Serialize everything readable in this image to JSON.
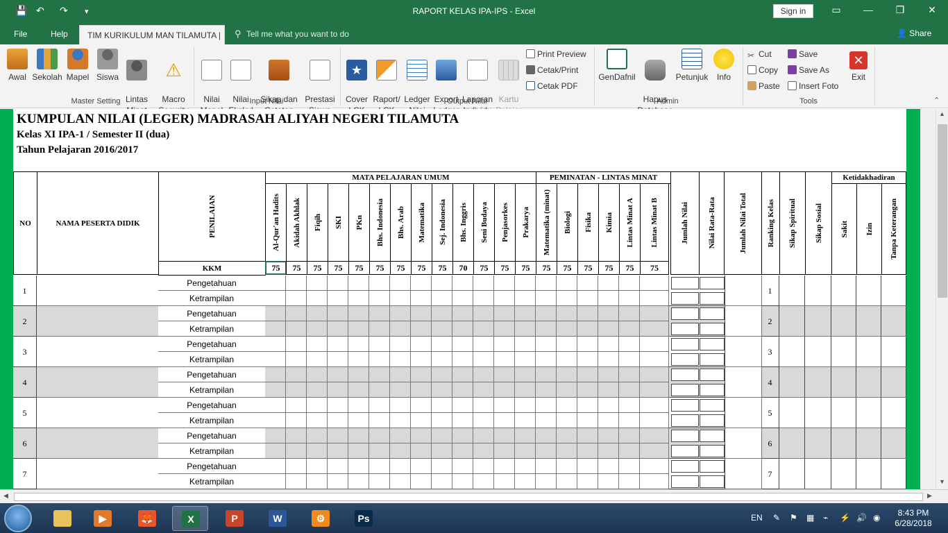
{
  "titlebar": {
    "title": "RAPORT KELAS IPA-IPS  -  Excel",
    "signin": "Sign in",
    "save_icon": "💾",
    "undo_icon": "↶",
    "redo_icon": "↷",
    "customize_icon": "▾",
    "ribbon_display_icon": "▭",
    "minimize_icon": "—",
    "restore_icon": "❐",
    "close_icon": "✕"
  },
  "tabs": {
    "file": "File",
    "help": "Help",
    "active": "TIM KURIKULUM MAN TILAMUTA |",
    "tellme": "Tell me what you want to do",
    "share": "Share"
  },
  "ribbon": {
    "groups": {
      "master": "Master Setting",
      "input": "Input Nilai",
      "output": "Output Nilai",
      "admin": "Admin",
      "tools": "Tools"
    },
    "buttons": {
      "awal": "Awal",
      "sekolah": "Sekolah",
      "mapel": "Mapel",
      "siswa": "Siswa",
      "lintas_minat": "Lintas\nMinat",
      "macro_security": "Macro\nSecurity",
      "nilai_mapel": "Nilai\nMapel",
      "nilai_ekskul": "Nilai\nEkskul",
      "sikap_catatan": "Sikap dan\nCatatan Wali",
      "prestasi_siswa": "Prestasi\nSiswa",
      "cover_lck": "Cover\nLCK",
      "raport_lck": "Raport/\nLCK",
      "ledger_nilai": "Ledger\nNilai",
      "export_ledger": "Export\nLedger",
      "laporan_individu": "Laporan\nIndividu",
      "kartu_pelajar": "Kartu\nPelajar",
      "print_preview": "Print Preview",
      "cetak_print": "Cetak/Print",
      "cetak_pdf": "Cetak PDF",
      "gendafnil": "GenDafnil",
      "hapus_database": "Hapus\nDatabase",
      "petunjuk": "Petunjuk",
      "info": "Info",
      "cut": "Cut",
      "copy": "Copy",
      "paste": "Paste",
      "save": "Save",
      "save_as": "Save As",
      "insert_foto": "Insert Foto",
      "exit": "Exit"
    }
  },
  "sheet": {
    "title": "KUMPULAN NILAI (LEGER) MADRASAH ALIYAH NEGERI TILAMUTA",
    "subtitle1": "Kelas XI IPA-1 / Semester II (dua)",
    "subtitle2": "Tahun Pelajaran 2016/2017",
    "col_no": "NO",
    "col_nama": "NAMA PESERTA DIDIK",
    "col_penilaian": "PENILAIAN",
    "kkm_label": "KKM",
    "group_umum": "MATA PELAJARAN UMUM",
    "group_peminatan": "PEMINATAN - LINTAS MINAT",
    "group_ketidakhadiran": "Ketidakhadiran",
    "subjects_umum": [
      "Al-Qur'an Hadits",
      "Akidah Akhlak",
      "Fiqih",
      "SKI",
      "PKn",
      "Bhs. Indonesia",
      "Bhs. Arab",
      "Matematika",
      "Sej. Indonesia",
      "Bhs. Inggris",
      "Seni Budaya",
      "Penjasorkes",
      "Prakarya"
    ],
    "subjects_peminatan": [
      "Matematika (minat)",
      "Biologi",
      "Fisika",
      "Kimia",
      "Lintas Minat  A",
      "Lintas Minat  B"
    ],
    "kkm_umum": [
      "75",
      "75",
      "75",
      "75",
      "75",
      "75",
      "75",
      "75",
      "75",
      "70",
      "75",
      "75",
      "75"
    ],
    "kkm_peminatan": [
      "75",
      "75",
      "75",
      "75",
      "75",
      "75"
    ],
    "col_jumlah": "Jumlah Nilai",
    "col_rata": "Nilai Rata-Rata",
    "col_total": "Jumlah Nilai Total",
    "col_ranking": "Ranking Kelas",
    "col_spiritual": "Sikap Spiritual",
    "col_sosial": "Sikap Sosial",
    "col_sakit": "Sakit",
    "col_izin": "Izin",
    "col_tanpa": "Tanpa Keterangan",
    "label_pengetahuan": "Pengetahuan",
    "label_ketrampilan": "Ketrampilan",
    "rows": [
      "1",
      "2",
      "3",
      "4",
      "5",
      "6",
      "7"
    ]
  },
  "taskbar": {
    "lang": "EN",
    "time": "8:43 PM",
    "date": "6/28/2018",
    "apps": [
      "file-explorer-icon",
      "media-player-icon",
      "firefox-icon",
      "excel-icon",
      "powerpoint-icon",
      "word-icon",
      "settings-app-icon",
      "photoshop-icon"
    ]
  }
}
